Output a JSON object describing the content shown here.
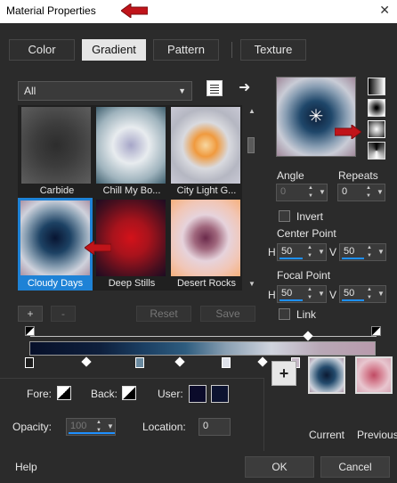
{
  "window": {
    "title": "Material Properties",
    "close_glyph": "✕"
  },
  "tabs": [
    {
      "label": "Color"
    },
    {
      "label": "Gradient"
    },
    {
      "label": "Pattern"
    },
    {
      "label": "Texture"
    }
  ],
  "library": {
    "filter_value": "All",
    "gradients": [
      {
        "label": "Carbide"
      },
      {
        "label": "Chill My Bo..."
      },
      {
        "label": "City Light G..."
      },
      {
        "label": "Cloudy Days",
        "selected": true
      },
      {
        "label": "Deep Stills"
      },
      {
        "label": "Desert Rocks"
      }
    ],
    "add_label": "+",
    "remove_label": "-",
    "reset_label": "Reset",
    "save_label": "Save"
  },
  "properties": {
    "angle_label": "Angle",
    "angle_value": "0",
    "repeats_label": "Repeats",
    "repeats_value": "0",
    "invert_label": "Invert",
    "center_point_label": "Center Point",
    "center_h_label": "H",
    "center_h_value": "50",
    "center_v_label": "V",
    "center_v_value": "50",
    "focal_point_label": "Focal Point",
    "focal_h_label": "H",
    "focal_h_value": "50",
    "focal_v_label": "V",
    "focal_v_value": "50",
    "link_label": "Link"
  },
  "stops": {
    "fore_label": "Fore:",
    "back_label": "Back:",
    "user_label": "User:",
    "opacity_label": "Opacity:",
    "opacity_value": "100",
    "location_label": "Location:",
    "location_value": "0"
  },
  "swatches": {
    "current_label": "Current",
    "previous_label": "Previous"
  },
  "footer": {
    "help_label": "Help",
    "ok_label": "OK",
    "cancel_label": "Cancel"
  }
}
